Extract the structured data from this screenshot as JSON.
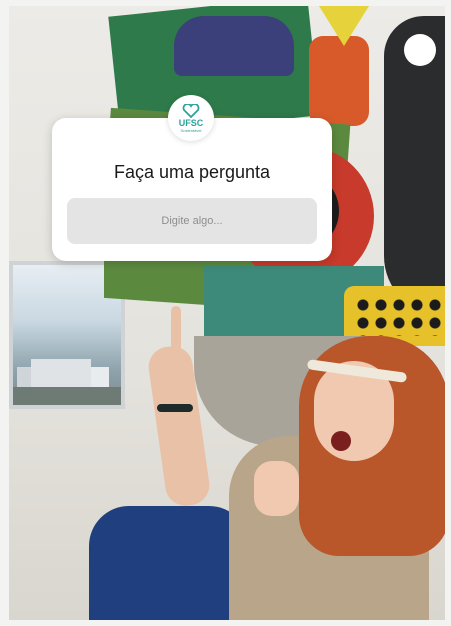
{
  "question_sticker": {
    "logo": {
      "text": "UFSC",
      "subtext": "Sustentável",
      "color": "#2aa39a",
      "icon": "heart-icon"
    },
    "title": "Faça uma pergunta",
    "input_placeholder": "Digite algo..."
  },
  "colors": {
    "sticker_bg": "#ffffff",
    "field_bg": "#e4e4e4",
    "placeholder": "#8e8e8e",
    "accent": "#2aa39a"
  }
}
